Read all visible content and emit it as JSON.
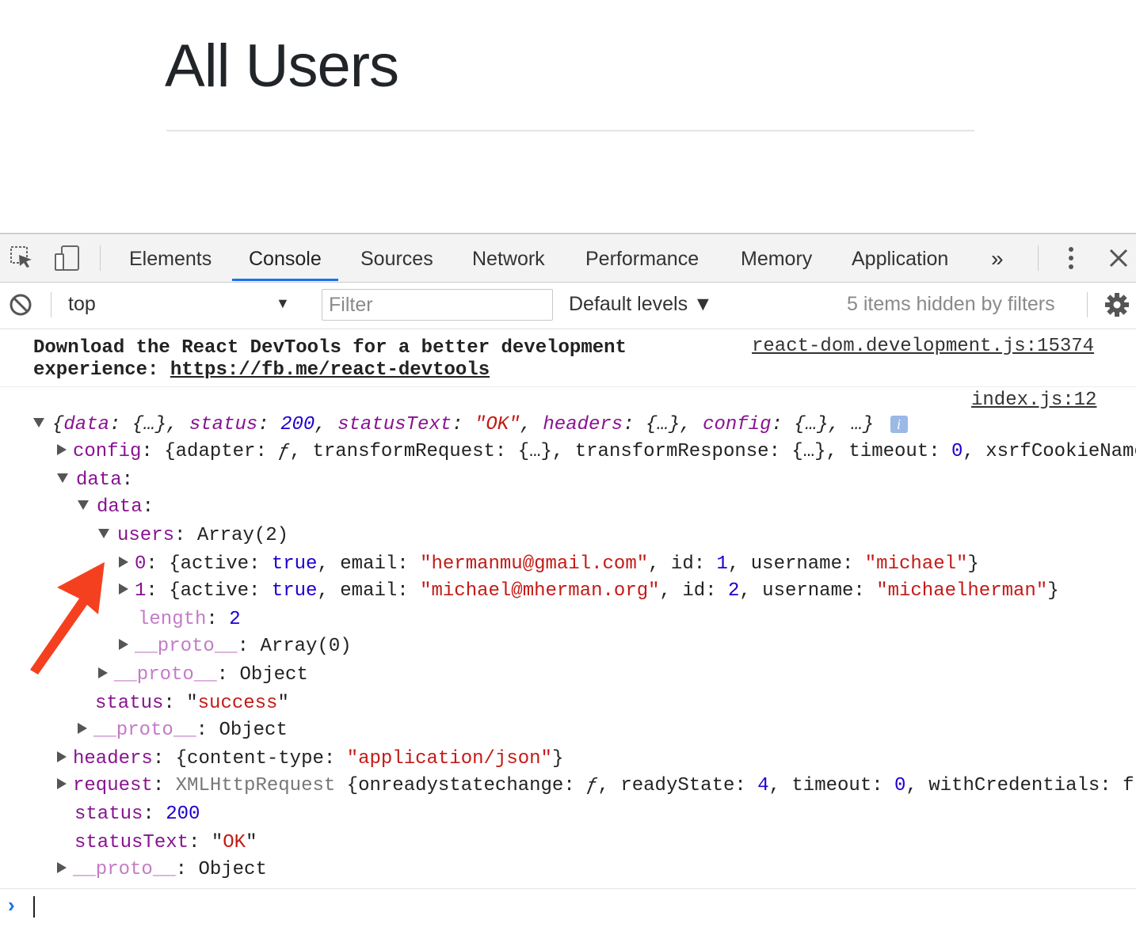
{
  "page": {
    "title": "All Users"
  },
  "devtools": {
    "tabs": [
      "Elements",
      "Console",
      "Sources",
      "Network",
      "Performance",
      "Memory",
      "Application"
    ],
    "active_tab": "Console",
    "more_tabs_glyph": "»",
    "context": "top",
    "filter_placeholder": "Filter",
    "levels": "Default levels ▼",
    "hidden_count": "5 items hidden by filters",
    "accent": "#1a73e8"
  },
  "console": {
    "warning": {
      "line1": "Download the React DevTools for a better development",
      "line2_prefix": "experience: ",
      "link": "https://fb.me/react-devtools",
      "source": "react-dom.development.js:15374"
    },
    "log_source": "index.js:12",
    "summary": {
      "t1": "{",
      "k_data": "data",
      "v_data": "{…}",
      "k_status": "status",
      "v_status": "200",
      "k_statusText": "statusText",
      "v_statusText": "\"OK\"",
      "k_headers": "headers",
      "v_headers": "{…}",
      "k_config": "config",
      "v_config": "{…}",
      "tail": ", …}",
      "info": "i"
    },
    "rows": {
      "config_key": "config",
      "config_val_pre": "{adapter: ",
      "config_f": "ƒ",
      "config_val_mid": ", transformRequest: {…}, transformResponse: {…}, timeout: ",
      "config_timeout": "0",
      "config_val_end": ", xsrfCookieName",
      "data_key": "data",
      "inner_data_key": "data",
      "users_key": "users",
      "users_val": "Array(2)",
      "u0_idx": "0",
      "u0_pre": "{active: ",
      "u0_active": "true",
      "u0_email_k": ", email: ",
      "u0_email": "\"hermanmu@gmail.com\"",
      "u0_id_k": ", id: ",
      "u0_id": "1",
      "u0_user_k": ", username: ",
      "u0_user": "\"michael\"",
      "u1_idx": "1",
      "u1_email": "\"michael@mherman.org\"",
      "u1_id": "2",
      "u1_user": "\"michaelherman\"",
      "close": "}",
      "length_key": "length",
      "length_val": "2",
      "proto_key": "__proto__",
      "proto_array": "Array(0)",
      "proto_object": "Object",
      "status_key": "status",
      "status_success": "\"success\"",
      "headers_key": "headers",
      "headers_pre": "{content-type: ",
      "headers_val": "\"application/json\"",
      "request_key": "request",
      "request_type": "XMLHttpRequest",
      "request_pre": " {onreadystatechange: ",
      "request_mid1": ", readyState: ",
      "request_ready": "4",
      "request_mid2": ", timeout: ",
      "request_timeout": "0",
      "request_end": ", withCredentials: f",
      "status_val": "200",
      "statusText_key": "statusText",
      "statusText_val": "\"OK\""
    },
    "prompt": "›"
  },
  "annotation": {
    "arrow_color": "#f5401f"
  }
}
